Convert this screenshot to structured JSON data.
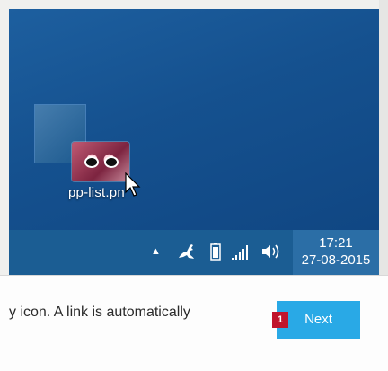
{
  "desktop": {
    "icon_label": "pp-list.pn",
    "icon_name": "image-file-icon"
  },
  "taskbar": {
    "tray_icons": [
      "chevron-up-icon",
      "kangaroo-app-icon",
      "battery-icon",
      "signal-icon",
      "volume-icon"
    ],
    "clock_time": "17:21",
    "clock_date": "27-08-2015"
  },
  "dialog": {
    "text": "y icon. A link is automatically",
    "next_label": "Next",
    "step_number": "1"
  },
  "colors": {
    "desktop_blue": "#15518f",
    "taskbar_blue": "#1b5d93",
    "button_blue": "#29a9e6",
    "badge_red": "#c0142c"
  }
}
